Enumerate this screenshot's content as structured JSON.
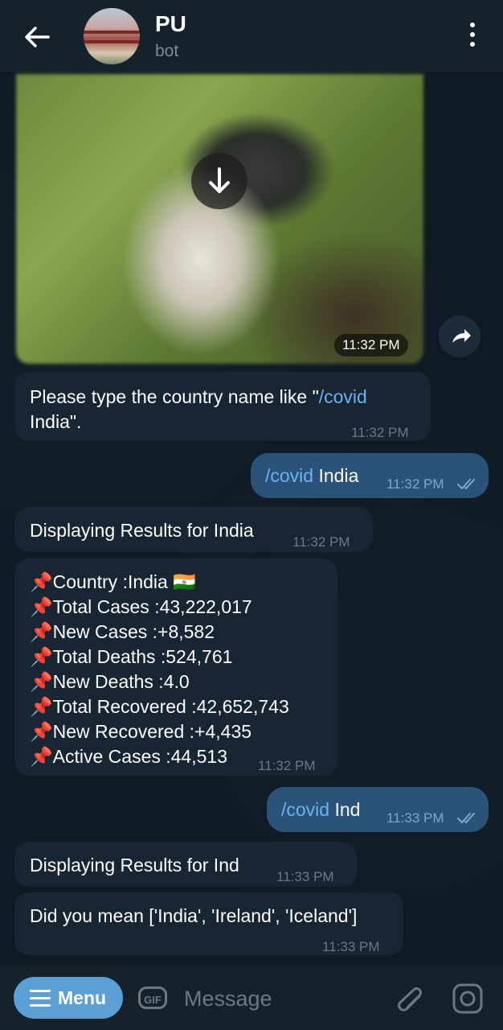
{
  "header": {
    "title": "PU",
    "subtitle": "bot"
  },
  "photo_message": {
    "time": "11:32 PM"
  },
  "messages": [
    {
      "type": "in",
      "text_before": "Please type the country name like \"",
      "command": "/covid",
      "text_after_line2": "India\".",
      "time": "11:32 PM"
    },
    {
      "type": "out",
      "command": "/covid",
      "text": "India",
      "time": "11:32 PM"
    },
    {
      "type": "in",
      "text": "Displaying Results for India",
      "time": "11:32 PM"
    },
    {
      "type": "in",
      "lines": [
        "Country :India 🇮🇳",
        "Total Cases :43,222,017",
        "New Cases :+8,582",
        "Total Deaths :524,761",
        "New Deaths :4.0",
        "Total Recovered :42,652,743",
        "New Recovered :+4,435",
        "Active Cases :44,513"
      ],
      "bullet": "📌",
      "time": "11:32 PM"
    },
    {
      "type": "out",
      "command": "/covid",
      "text": "Ind",
      "time": "11:33 PM"
    },
    {
      "type": "in",
      "text": "Displaying Results for Ind",
      "time": "11:33 PM"
    },
    {
      "type": "in",
      "text": "Did you mean ['India', 'Ireland', 'Iceland']",
      "time": "11:33 PM"
    }
  ],
  "input_bar": {
    "menu_label": "Menu",
    "gif_label": "GIF",
    "placeholder": "Message"
  }
}
